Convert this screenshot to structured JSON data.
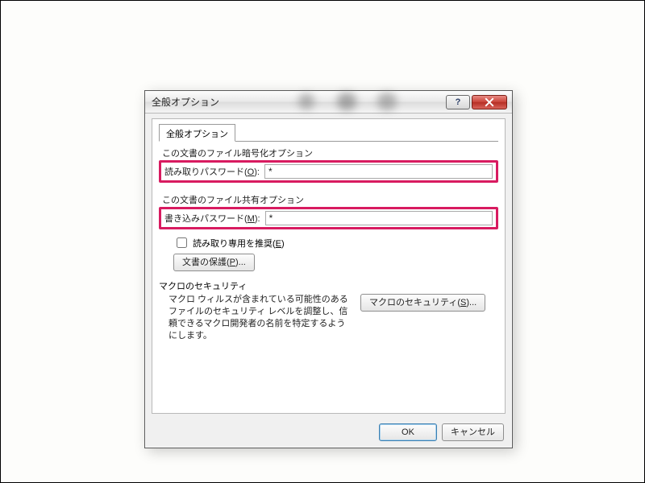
{
  "dialog": {
    "title": "全般オプション",
    "tab_label": "全般オプション",
    "encryption": {
      "group_label": "この文書のファイル暗号化オプション",
      "field_label_pre": "読み取りパスワード(",
      "field_accel": "O",
      "field_label_post": "):",
      "value": "*"
    },
    "sharing": {
      "group_label": "この文書のファイル共有オプション",
      "field_label_pre": "書き込みパスワード(",
      "field_accel": "M",
      "field_label_post": "):",
      "value": "*"
    },
    "readonly": {
      "label_pre": "読み取り専用を推奨(",
      "accel": "E",
      "label_post": ")"
    },
    "protect_btn": {
      "label_pre": "文書の保護(",
      "accel": "P",
      "label_post": ")..."
    },
    "macro": {
      "section_label": "マクロのセキュリティ",
      "desc": "マクロ ウィルスが含まれている可能性のあるファイルのセキュリティ レベルを調整し、信頼できるマクロ開発者の名前を特定するようにします。",
      "btn_pre": "マクロのセキュリティ(",
      "btn_accel": "S",
      "btn_post": ")..."
    },
    "footer": {
      "ok": "OK",
      "cancel": "キャンセル"
    }
  }
}
